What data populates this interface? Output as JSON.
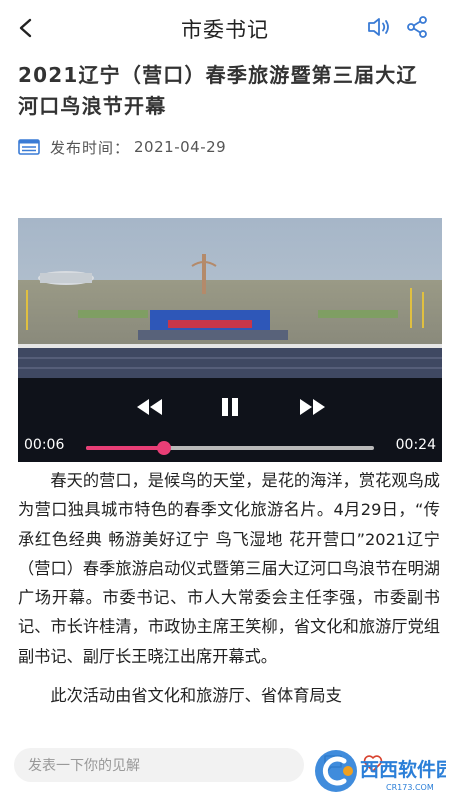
{
  "header": {
    "back_icon": "chevron-left-icon",
    "title": "市委书记",
    "speaker_icon": "speaker-icon",
    "share_icon": "share-icon"
  },
  "article": {
    "title": "2021辽宁（营口）春季旅游暨第三届大辽河口鸟浪节开幕",
    "meta_label": "发布时间：",
    "publish_date": "2021-04-29"
  },
  "video": {
    "current_time": "00:06",
    "total_time": "00:24",
    "progress": 0.27
  },
  "body": {
    "paragraphs": [
      "春天的营口，是候鸟的天堂，是花的海洋，赏花观鸟成为营口独具城市特色的春季文化旅游名片。4月29日，“传承红色经典 畅游美好辽宁 鸟飞湿地 花开营口”2021辽宁（营口）春季旅游启动仪式暨第三届大辽河口鸟浪节在明湖广场开幕。市委书记、市人大常委会主任李强，市委副书记、市长许桂清，市政协主席王笑柳，省文化和旅游厅党组副书记、副厅长王晓江出席开幕式。",
      "此次活动由省文化和旅游厅、省体育局支"
    ]
  },
  "bottom_bar": {
    "comment_placeholder": "发表一下你的见解"
  },
  "watermark": {
    "brand": "西西软件园",
    "url": "CR173.COM"
  },
  "colors": {
    "accent_progress": "#e83e76",
    "link_blue": "#3a7bd5"
  }
}
